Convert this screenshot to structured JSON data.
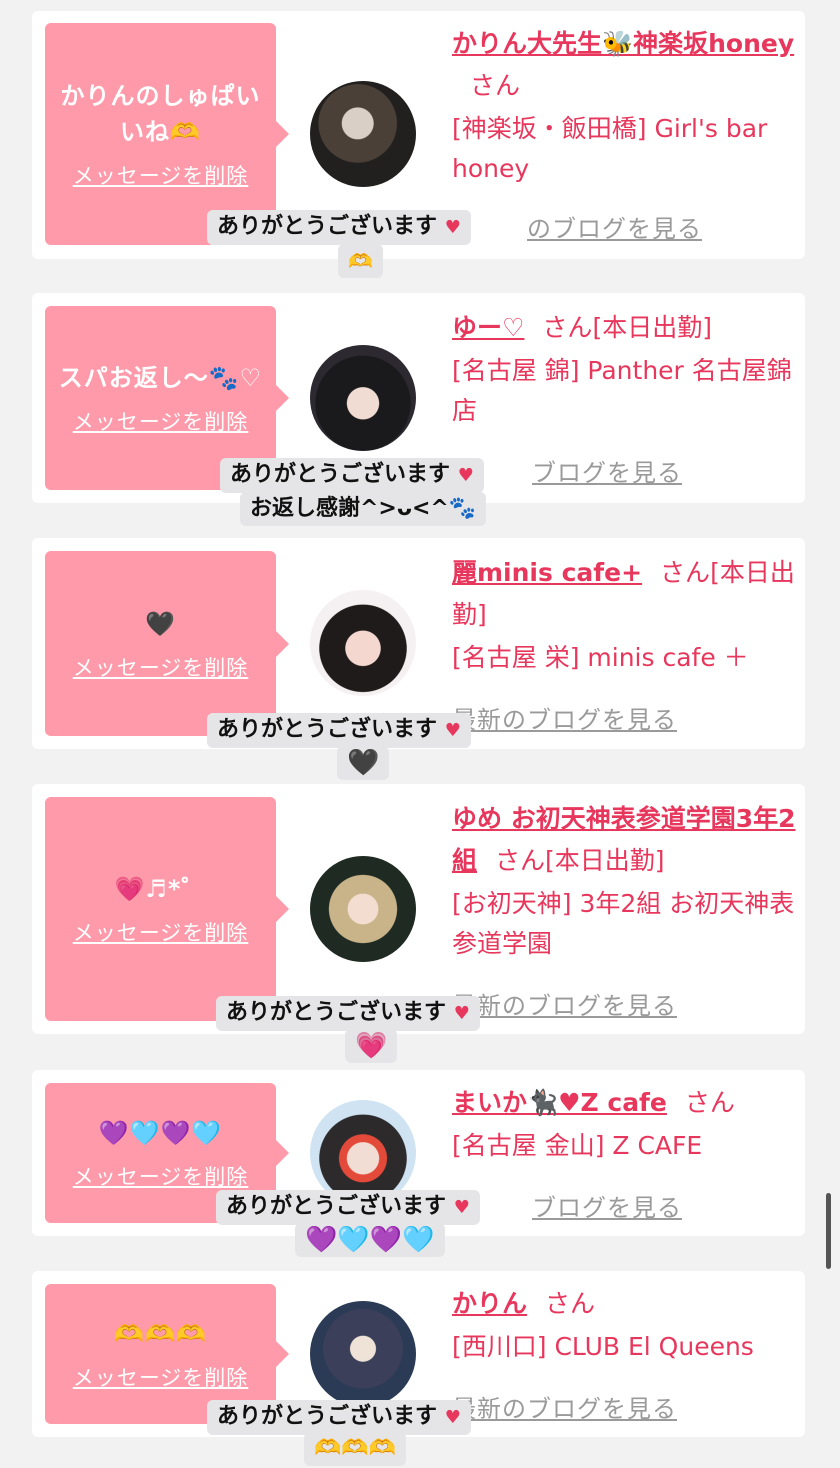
{
  "common": {
    "delete_label": "メッセージを削除",
    "thanks_text": "ありがとうございます",
    "san": "さん",
    "blog_label": "最新のブログを見る",
    "envelope_icon": "♥"
  },
  "items": [
    {
      "message_line1": "かりんのしゅぱい",
      "message_line2": "いね🫶",
      "name": "かりん大先生🐝神楽坂honey",
      "status": "",
      "shop": "[神楽坂・飯田橋] Girl's bar honey",
      "blog_visible": "のブログを見る",
      "tooltip_line2": "🫶"
    },
    {
      "message_line1": "スパお返し〜🐾♡",
      "message_line2": "",
      "name": "ゆー♡",
      "status": "[本日出勤]",
      "shop": "[名古屋 錦] Panther 名古屋錦店",
      "blog_visible": "ブログを見る",
      "tooltip_line2": "お返し感謝^>ᴗ<^🐾"
    },
    {
      "message_line1": "🖤",
      "message_line2": "",
      "name": "麗minis cafe+",
      "status": "[本日出勤]",
      "shop": "[名古屋 栄] minis cafe ＋",
      "blog_visible": "最新のブログを見る",
      "tooltip_line2": "🖤"
    },
    {
      "message_line1": "💗♬*゜",
      "message_line2": "",
      "name": "ゆめ お初天神表参道学園3年2組",
      "status": "[本日出勤]",
      "shop": "[お初天神] 3年2組 お初天神表参道学園",
      "blog_visible": "最新のブログを見る",
      "tooltip_line2": "💗"
    },
    {
      "message_line1": "💜🩵💜🩵",
      "message_line2": "",
      "name": "まいか🐈‍⬛♥Z cafe",
      "status": "",
      "shop": "[名古屋 金山] Z CAFE",
      "blog_visible": "ブログを見る",
      "tooltip_line2": "💜🩵💜🩵"
    },
    {
      "message_line1": "🫶🫶🫶",
      "message_line2": "",
      "name": "かりん",
      "status": "",
      "shop": "[西川口] CLUB El Queens",
      "blog_visible": "最新のブログを見る",
      "tooltip_line2": "🫶🫶🫶"
    }
  ]
}
